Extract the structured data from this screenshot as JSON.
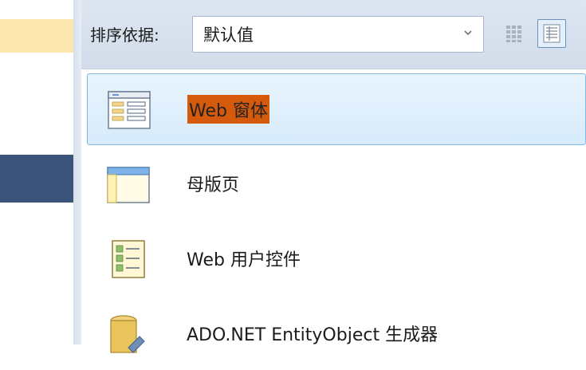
{
  "toolbar": {
    "sort_label": "排序依据:",
    "sort_value": "默认值",
    "view_buttons": [
      {
        "icon": "small-icons-view-icon",
        "active": false
      },
      {
        "icon": "medium-icons-view-icon",
        "active": true
      }
    ]
  },
  "templates": [
    {
      "label": "Web 窗体",
      "icon": "web-form-icon",
      "selected": true
    },
    {
      "label": "母版页",
      "icon": "master-page-icon",
      "selected": false
    },
    {
      "label": "Web 用户控件",
      "icon": "user-control-icon",
      "selected": false
    },
    {
      "label": "ADO.NET EntityObject 生成器",
      "icon": "entity-generator-icon",
      "selected": false
    }
  ],
  "colors": {
    "selection_highlight": "#d65a0c",
    "selected_row_bg": "#d7ebfb",
    "toolbar_bg": "#d2dcea",
    "left_selected_band": "#3c547a",
    "left_top_band": "#fde6b0"
  }
}
